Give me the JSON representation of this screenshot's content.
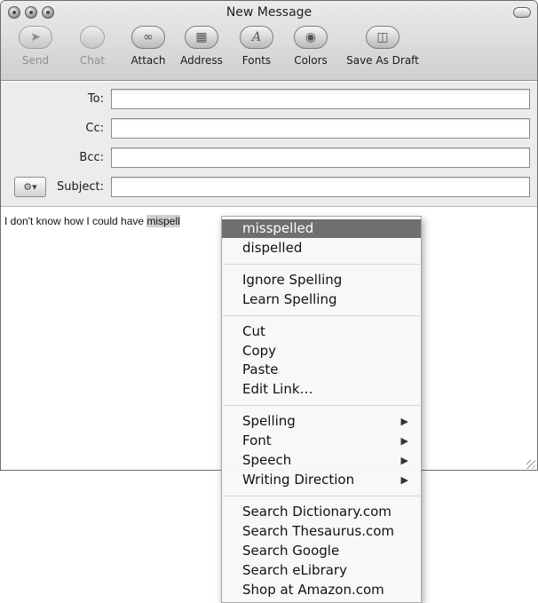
{
  "window": {
    "title": "New Message"
  },
  "toolbar": {
    "buttons": [
      {
        "label": "Send",
        "icon": "send-icon",
        "enabled": false
      },
      {
        "label": "Chat",
        "icon": "chat-icon",
        "enabled": false
      },
      {
        "label": "Attach",
        "icon": "paperclip-icon",
        "enabled": true
      },
      {
        "label": "Address",
        "icon": "address-book-icon",
        "enabled": true
      },
      {
        "label": "Fonts",
        "icon": "fonts-icon",
        "enabled": true
      },
      {
        "label": "Colors",
        "icon": "color-wheel-icon",
        "enabled": true
      },
      {
        "label": "Save As Draft",
        "icon": "draft-icon",
        "enabled": true
      }
    ]
  },
  "fields": {
    "to": {
      "label": "To:",
      "value": ""
    },
    "cc": {
      "label": "Cc:",
      "value": ""
    },
    "bcc": {
      "label": "Bcc:",
      "value": ""
    },
    "subject": {
      "label": "Subject:",
      "value": ""
    }
  },
  "message": {
    "text_before": "I don't know how I could have ",
    "selected_word": "mispell"
  },
  "context_menu": {
    "suggestions": [
      "misspelled",
      "dispelled"
    ],
    "spelling_actions": [
      "Ignore Spelling",
      "Learn Spelling"
    ],
    "edit_actions": [
      "Cut",
      "Copy",
      "Paste",
      "Edit Link…"
    ],
    "submenus": [
      "Spelling",
      "Font",
      "Speech",
      "Writing Direction"
    ],
    "search_actions": [
      "Search Dictionary.com",
      "Search Thesaurus.com",
      "Search Google",
      "Search eLibrary",
      "Shop at Amazon.com"
    ]
  },
  "colors": {
    "menu_highlight": "#6f6f6f",
    "selection": "#cfcfcf"
  }
}
